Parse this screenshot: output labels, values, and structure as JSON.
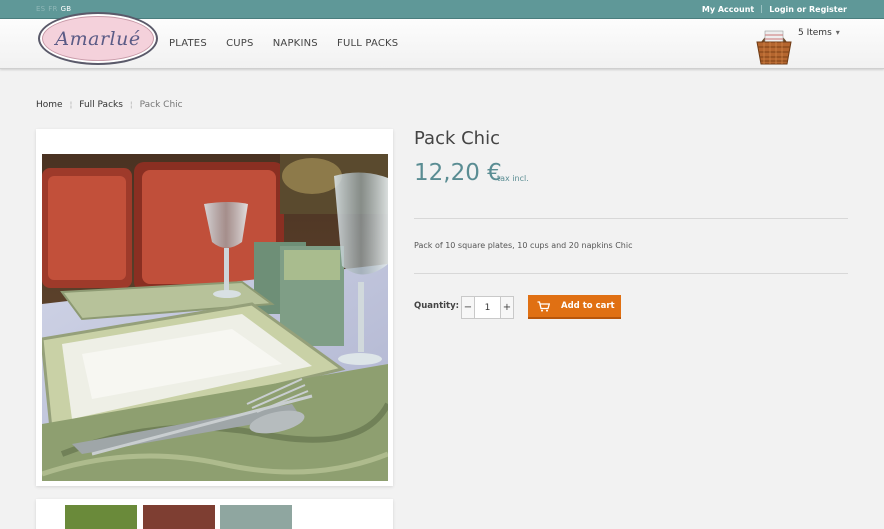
{
  "topbar": {
    "languages": [
      {
        "code": "ES",
        "active": false
      },
      {
        "code": "FR",
        "active": false
      },
      {
        "code": "GB",
        "active": true
      }
    ],
    "my_account": "My Account",
    "login_register": "Login or Register"
  },
  "header": {
    "logo_text": "Amarlué",
    "nav": [
      "PLATES",
      "CUPS",
      "NAPKINS",
      "FULL PACKS"
    ],
    "cart_label": "5 Items",
    "cart_icon": "picnic-basket-icon"
  },
  "breadcrumb": [
    "Home",
    "Full Packs",
    "Pack Chic"
  ],
  "product": {
    "title": "Pack Chic",
    "price": "12,20 €",
    "tax_note": "tax incl.",
    "description": "Pack of 10 square plates, 10 cups and 20 napkins Chic",
    "quantity_label": "Quantity:",
    "quantity": "1",
    "minus": "−",
    "plus": "+",
    "add_to_cart": "Add to cart"
  },
  "colors": {
    "topbar": "#5f9898",
    "price": "#5a8d93",
    "add_to_cart": "#e07013"
  }
}
